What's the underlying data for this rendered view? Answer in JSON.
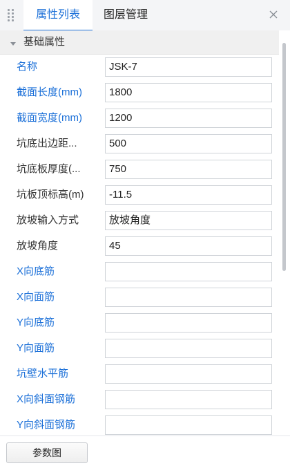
{
  "header": {
    "tabs": [
      {
        "label": "属性列表",
        "active": true
      },
      {
        "label": "图层管理",
        "active": false
      }
    ],
    "close_icon": "close-icon"
  },
  "group": {
    "title": "基础属性",
    "icon": "collapse-triangle-icon"
  },
  "rows": [
    {
      "label": "名称",
      "value": "JSK-7",
      "label_color": "blue"
    },
    {
      "label": "截面长度(mm)",
      "value": "1800",
      "label_color": "blue"
    },
    {
      "label": "截面宽度(mm)",
      "value": "1200",
      "label_color": "blue"
    },
    {
      "label": "坑底出边距...",
      "value": "500",
      "label_color": "dark"
    },
    {
      "label": "坑底板厚度(...",
      "value": "750",
      "label_color": "dark"
    },
    {
      "label": "坑板顶标高(m)",
      "value": "-11.5",
      "label_color": "dark"
    },
    {
      "label": "放坡输入方式",
      "value": "放坡角度",
      "label_color": "dark"
    },
    {
      "label": "放坡角度",
      "value": "45",
      "label_color": "dark"
    },
    {
      "label": "X向底筋",
      "value": "",
      "label_color": "blue"
    },
    {
      "label": "X向面筋",
      "value": "",
      "label_color": "blue"
    },
    {
      "label": "Y向底筋",
      "value": "",
      "label_color": "blue"
    },
    {
      "label": "Y向面筋",
      "value": "",
      "label_color": "blue"
    },
    {
      "label": "坑壁水平筋",
      "value": "",
      "label_color": "blue"
    },
    {
      "label": "X向斜面钢筋",
      "value": "",
      "label_color": "blue"
    },
    {
      "label": "Y向斜面钢筋",
      "value": "",
      "label_color": "blue"
    }
  ],
  "footer": {
    "button_label": "参数图"
  },
  "colors": {
    "accent": "#1a6fd8",
    "label_dark": "#333333",
    "group_bg": "#f0f0f0"
  }
}
